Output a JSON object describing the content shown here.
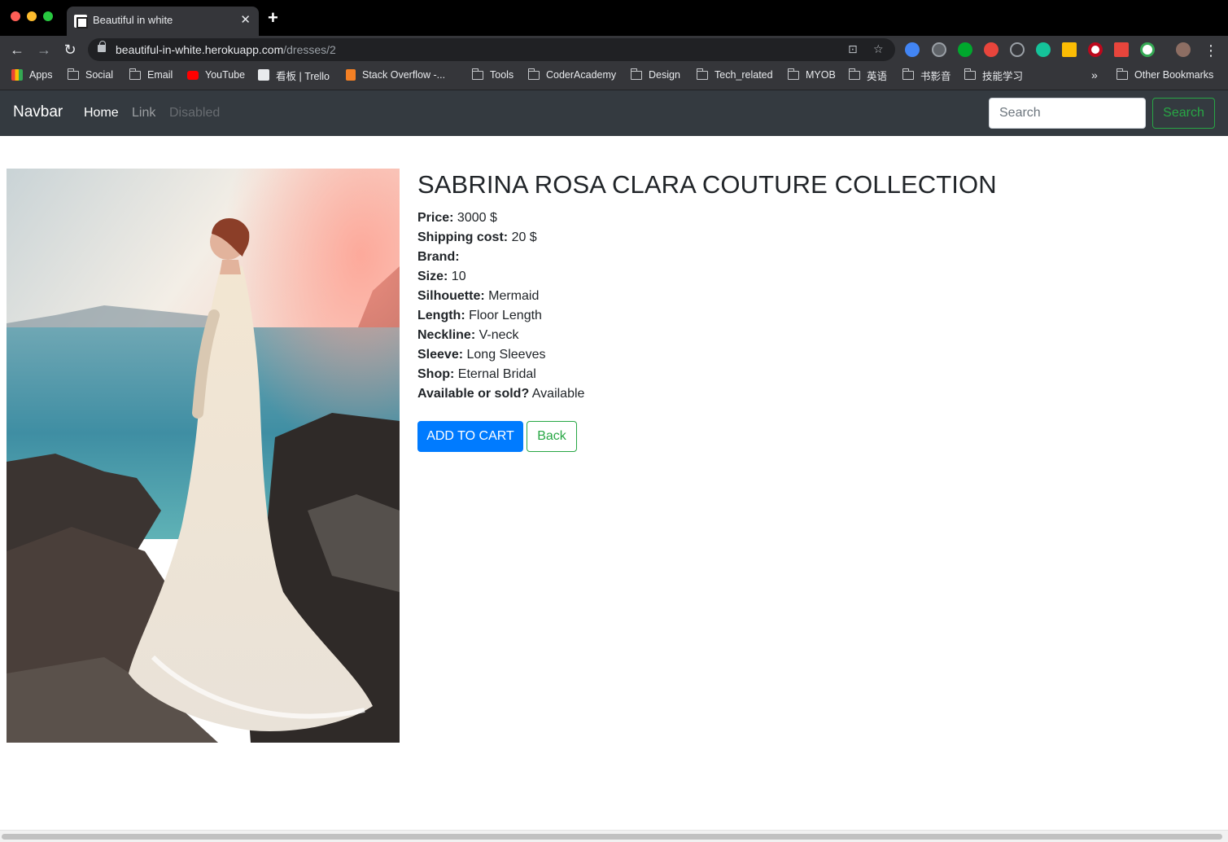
{
  "browser": {
    "tab_title": "Beautiful in white",
    "url_host": "beautiful-in-white.herokuapp.com",
    "url_path": "/dresses/2",
    "bookmarks": [
      "Apps",
      "Social",
      "Email",
      "YouTube",
      "看板 | Trello",
      "Stack Overflow -...",
      "Tools",
      "CoderAcademy",
      "Design",
      "Tech_related",
      "MYOB",
      "英语",
      "书影音",
      "技能学习"
    ],
    "overflow": "»",
    "other_bookmarks": "Other Bookmarks"
  },
  "navbar": {
    "brand": "Navbar",
    "links": [
      "Home",
      "Link",
      "Disabled"
    ],
    "search_placeholder": "Search",
    "search_button": "Search"
  },
  "dress": {
    "title": "SABRINA ROSA CLARA COUTURE COLLECTION",
    "fields": [
      {
        "label": "Price:",
        "value": "3000 $"
      },
      {
        "label": "Shipping cost:",
        "value": "20 $"
      },
      {
        "label": "Brand:",
        "value": ""
      },
      {
        "label": "Size:",
        "value": "10"
      },
      {
        "label": "Silhouette:",
        "value": "Mermaid"
      },
      {
        "label": "Length:",
        "value": "Floor Length"
      },
      {
        "label": "Neckline:",
        "value": "V-neck"
      },
      {
        "label": "Sleeve:",
        "value": "Long Sleeves"
      },
      {
        "label": "Shop:",
        "value": "Eternal Bridal"
      },
      {
        "label": "Available or sold?",
        "value": "Available"
      }
    ],
    "add_to_cart": "ADD TO CART",
    "back": "Back"
  },
  "colors": {
    "navbar_bg": "#343a40",
    "primary": "#007bff",
    "success": "#28a745"
  }
}
